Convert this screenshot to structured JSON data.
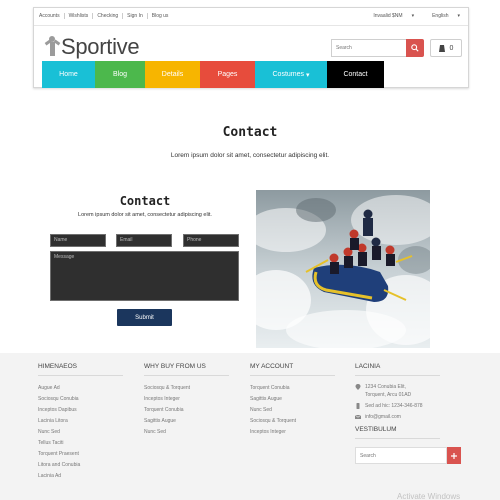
{
  "topbar": {
    "links": [
      "Accounts",
      "Wishlists",
      "Checking",
      "Sign In",
      "Blog us"
    ],
    "currency": "Invaalid $NM",
    "language": "English"
  },
  "logo": {
    "text": "Sportive",
    "icon": "person-icon"
  },
  "search": {
    "placeholder": "Search",
    "icon": "search-icon",
    "button_color": "#d9534f"
  },
  "cart": {
    "count": "0",
    "icon": "cart-icon"
  },
  "nav": {
    "items": [
      {
        "label": "Home",
        "color": "#19c0d6"
      },
      {
        "label": "Blog",
        "color": "#4cb84c"
      },
      {
        "label": "Details",
        "color": "#f7b500"
      },
      {
        "label": "Pages",
        "color": "#e74c3c"
      },
      {
        "label": "Costumes",
        "color": "#19c0d6",
        "caret": "▾"
      },
      {
        "label": "Contact",
        "color": "#000000"
      }
    ]
  },
  "main": {
    "title": "Contact",
    "subtitle": "Lorem ipsum dolor sit amet, consectetur adipiscing elit."
  },
  "form": {
    "title": "Contact",
    "subtitle": "Lorem ipsum dolor sit amet, consectetur adipiscing elit.",
    "name_placeholder": "Name",
    "email_placeholder": "Email",
    "phone_placeholder": "Phone",
    "message_placeholder": "Message",
    "submit_label": "Submit",
    "submit_color": "#1b365d"
  },
  "photo": {
    "subject": "rafting-photo"
  },
  "footer": {
    "col1": {
      "heading": "Himenaeos",
      "links": [
        "Augue Ad",
        "Sociosqu Conubia",
        "Inceptos Dapibus",
        "Lacinia Litora",
        "Nunc Sed",
        "Tellus Taciti",
        "Torquent Praesent",
        "Litora and Conubia",
        "Lacinia Ad"
      ]
    },
    "col2": {
      "heading": "Why buy from us",
      "links": [
        "Sociosqu & Torquent",
        "Inceptos Integer",
        "Torquent Conubia",
        "Sagittis Augue",
        "Nunc Sed"
      ]
    },
    "col3": {
      "heading": "My account",
      "links": [
        "Torquent Conubia",
        "Sagittis Augue",
        "Nunc Sed",
        "Sociosqu & Torquent",
        "Inceptos Integer"
      ]
    },
    "col4": {
      "heading": "Lacinia",
      "address": "1234 Conubia Elit,",
      "address2": "Torquent, Arcu 01AD",
      "phone": "Sed ad hic: 1234-346-878",
      "email": "info@gmail.com",
      "vestibulum": "Vestibulum",
      "newsletter_placeholder": "Search"
    }
  },
  "watermark": "Activate Windows"
}
